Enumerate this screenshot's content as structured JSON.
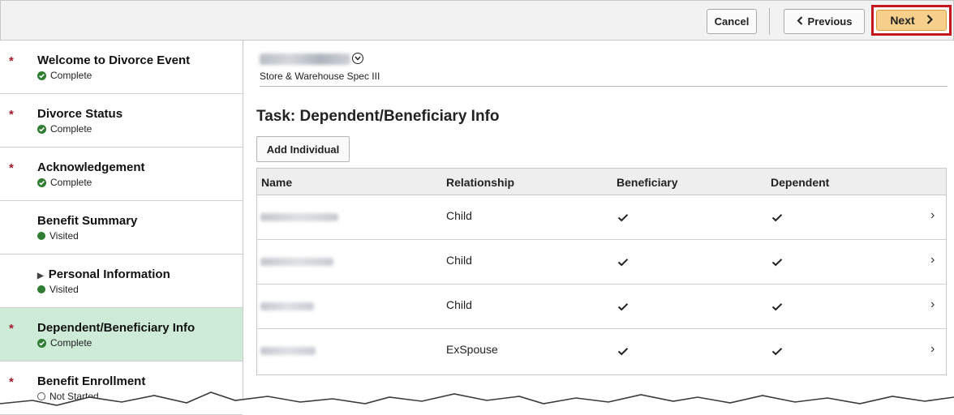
{
  "toolbar": {
    "cancel_label": "Cancel",
    "previous_label": "Previous",
    "next_label": "Next"
  },
  "sidebar": {
    "items": [
      {
        "title": "Welcome to Divorce Event",
        "status": "Complete",
        "required": true,
        "state": "complete",
        "active": false,
        "expandable": false
      },
      {
        "title": "Divorce Status",
        "status": "Complete",
        "required": true,
        "state": "complete",
        "active": false,
        "expandable": false
      },
      {
        "title": "Acknowledgement",
        "status": "Complete",
        "required": true,
        "state": "complete",
        "active": false,
        "expandable": false
      },
      {
        "title": "Benefit Summary",
        "status": "Visited",
        "required": false,
        "state": "visited",
        "active": false,
        "expandable": false
      },
      {
        "title": "Personal Information",
        "status": "Visited",
        "required": false,
        "state": "visited",
        "active": false,
        "expandable": true
      },
      {
        "title": "Dependent/Beneficiary Info",
        "status": "Complete",
        "required": true,
        "state": "complete",
        "active": true,
        "expandable": false
      },
      {
        "title": "Benefit Enrollment",
        "status": "Not Started",
        "required": true,
        "state": "not-started",
        "active": false,
        "expandable": false
      }
    ],
    "required_mark": "*"
  },
  "employee": {
    "job_title": "Store & Warehouse Spec III"
  },
  "task": {
    "title": "Task: Dependent/Beneficiary Info",
    "add_button_label": "Add Individual"
  },
  "grid": {
    "columns": [
      "Name",
      "Relationship",
      "Beneficiary",
      "Dependent"
    ],
    "rows": [
      {
        "relationship": "Child",
        "beneficiary": true,
        "dependent": true
      },
      {
        "relationship": "Child",
        "beneficiary": true,
        "dependent": true
      },
      {
        "relationship": "Child",
        "beneficiary": true,
        "dependent": true
      },
      {
        "relationship": "ExSpouse",
        "beneficiary": true,
        "dependent": true
      }
    ]
  },
  "colors": {
    "accent_red": "#c4161c",
    "next_button": "#f7cf8d",
    "active_step": "#cdebd7",
    "status_green": "#2e7d32",
    "required_mark": "#a6192e"
  }
}
